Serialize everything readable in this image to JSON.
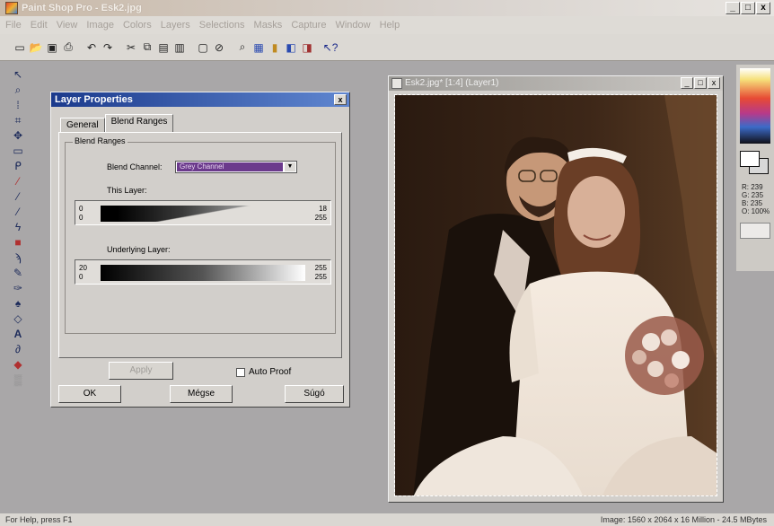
{
  "app": {
    "title": "Paint Shop Pro - Esk2.jpg",
    "window_buttons": [
      "_",
      "□",
      "x"
    ]
  },
  "menu": [
    "File",
    "Edit",
    "View",
    "Image",
    "Colors",
    "Layers",
    "Selections",
    "Masks",
    "Capture",
    "Window",
    "Help"
  ],
  "toolbar_icons": [
    "new-icon",
    "open-icon",
    "save-icon",
    "print-icon",
    "undo-icon",
    "redo-icon",
    "cut-icon",
    "copy-icon",
    "paste-icon",
    "paste-new-icon",
    "monitor-icon",
    "stop-icon",
    "zoom-icon",
    "palette-icon",
    "color-bars-icon",
    "layers-icon",
    "histogram-icon",
    "help-pointer-icon"
  ],
  "tools": [
    "arrow",
    "zoom",
    "deform",
    "crop",
    "mover",
    "selection",
    "freehand",
    "dropper",
    "paintbrush",
    "clone",
    "color-replacer",
    "retouch",
    "eraser",
    "picture-tube",
    "airbrush",
    "flood-fill",
    "text",
    "draw",
    "preset-shapes",
    "object"
  ],
  "dialog": {
    "title": "Layer Properties",
    "close": "x",
    "tabs": [
      "General",
      "Blend Ranges"
    ],
    "group_label": "Blend Ranges",
    "blend_channel_label": "Blend Channel:",
    "blend_channel_value": "Grey Channel",
    "this_layer": {
      "label": "This Layer:",
      "left_top": "0",
      "left_bottom": "0",
      "right_top": "18",
      "right_bottom": "255"
    },
    "underlying_layer": {
      "label": "Underlying Layer:",
      "left_top": "20",
      "left_bottom": "0",
      "right_top": "255",
      "right_bottom": "255"
    },
    "apply_label": "Apply",
    "auto_proof_label": "Auto Proof",
    "ok_label": "OK",
    "cancel_label": "Mégse",
    "help_label": "Súgó"
  },
  "image_window": {
    "title": "Esk2.jpg* [1:4] (Layer1)",
    "buttons": [
      "_",
      "□",
      "x"
    ]
  },
  "color_panel": {
    "r": "R: 239",
    "g": "G: 235",
    "b": "B: 235",
    "o": "O: 100%"
  },
  "status": {
    "left": "For Help, press F1",
    "right": "Image: 1560 x 2064 x 16 Million - 24.5 MBytes"
  }
}
